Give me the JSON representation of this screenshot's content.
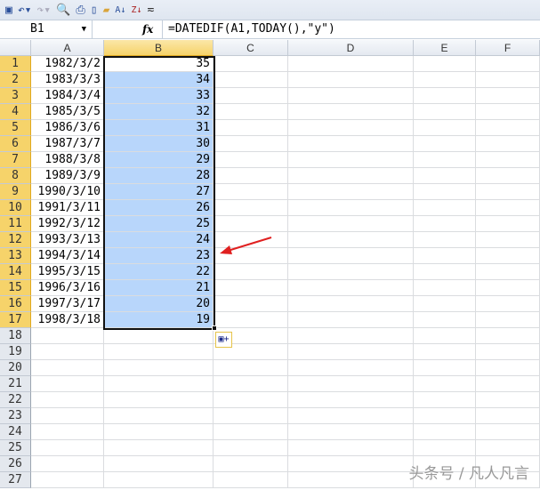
{
  "toolbar": {
    "icons": [
      "save-icon",
      "undo-icon",
      "redo-icon",
      "print-preview-icon",
      "print-icon",
      "new-icon",
      "open-icon",
      "sort-ascending-icon",
      "sort-descending-icon",
      "customize-icon"
    ]
  },
  "formula_bar": {
    "name_box": "B1",
    "fx_label": "fx",
    "formula": "=DATEDIF(A1,TODAY(),\"y\")"
  },
  "columns": [
    "A",
    "B",
    "C",
    "D",
    "E",
    "F"
  ],
  "rows": [
    "1",
    "2",
    "3",
    "4",
    "5",
    "6",
    "7",
    "8",
    "9",
    "10",
    "11",
    "12",
    "13",
    "14",
    "15",
    "16",
    "17",
    "18",
    "19",
    "20",
    "21",
    "22",
    "23",
    "24",
    "25",
    "26",
    "27"
  ],
  "col_a": [
    "1982/3/2",
    "1983/3/3",
    "1984/3/4",
    "1985/3/5",
    "1986/3/6",
    "1987/3/7",
    "1988/3/8",
    "1989/3/9",
    "1990/3/10",
    "1991/3/11",
    "1992/3/12",
    "1993/3/13",
    "1994/3/14",
    "1995/3/15",
    "1996/3/16",
    "1997/3/17",
    "1998/3/18"
  ],
  "col_b": [
    "35",
    "34",
    "33",
    "32",
    "31",
    "30",
    "29",
    "28",
    "27",
    "26",
    "25",
    "24",
    "23",
    "22",
    "21",
    "20",
    "19"
  ],
  "watermark": "头条号 / 凡人凡言",
  "annotation_color": "#e02020"
}
